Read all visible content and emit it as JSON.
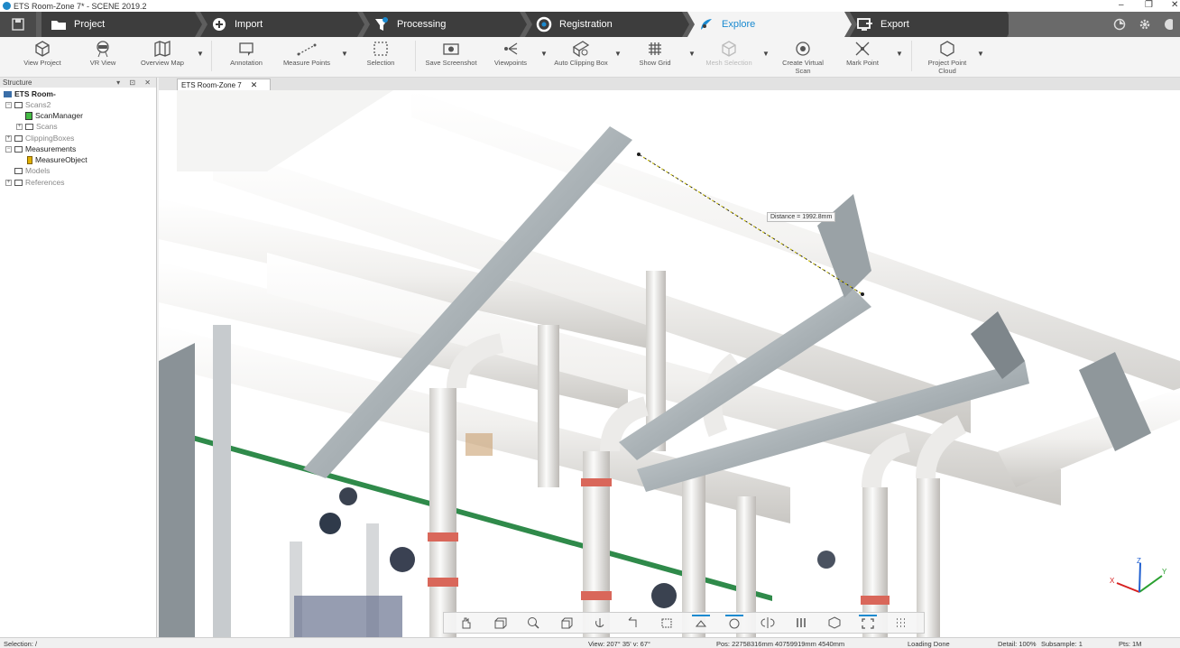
{
  "window": {
    "title": "ETS Room-Zone 7* - SCENE 2019.2",
    "controls": [
      "–",
      "❐",
      "✕"
    ]
  },
  "tabs": [
    {
      "label": "Project",
      "icon": "folder-icon"
    },
    {
      "label": "Import",
      "icon": "import-icon"
    },
    {
      "label": "Processing",
      "icon": "processing-icon"
    },
    {
      "label": "Registration",
      "icon": "registration-icon"
    },
    {
      "label": "Explore",
      "icon": "explore-icon",
      "active": true
    },
    {
      "label": "Export",
      "icon": "export-icon"
    }
  ],
  "ribbon": [
    {
      "label": "View Project",
      "icon": "cube-icon"
    },
    {
      "label": "VR View",
      "icon": "vr-icon"
    },
    {
      "label": "Overview Map",
      "icon": "map-icon"
    },
    {
      "label": "Annotation",
      "icon": "annotation-icon"
    },
    {
      "label": "Measure Points",
      "icon": "measure-icon"
    },
    {
      "label": "Selection",
      "icon": "selection-icon"
    },
    {
      "label": "Save Screenshot",
      "icon": "camera-icon"
    },
    {
      "label": "Viewpoints",
      "icon": "viewpoints-icon"
    },
    {
      "label": "Auto Clipping Box",
      "icon": "clipping-icon"
    },
    {
      "label": "Show Grid",
      "icon": "grid-icon"
    },
    {
      "label": "Mesh Selection",
      "icon": "mesh-icon",
      "disabled": true
    },
    {
      "label": "Create Virtual\nScan",
      "icon": "virtual-scan-icon"
    },
    {
      "label": "Mark Point",
      "icon": "mark-point-icon"
    },
    {
      "label": "Project Point\nCloud",
      "icon": "point-cloud-icon"
    }
  ],
  "structure": {
    "title": "Structure",
    "controls": "▾ ⊡ ✕",
    "nodes": [
      {
        "label": "ETS Room-"
      },
      {
        "label": "Scans2"
      },
      {
        "label": "ScanManager"
      },
      {
        "label": "Scans"
      },
      {
        "label": "ClippingBoxes"
      },
      {
        "label": "Measurements"
      },
      {
        "label": "MeasureObject"
      },
      {
        "label": "Models"
      },
      {
        "label": "References"
      }
    ]
  },
  "document_tab": {
    "label": "ETS Room-Zone 7",
    "close": "✕"
  },
  "measurement": {
    "label": "Distance = 1992.8mm"
  },
  "axes": {
    "x": "X",
    "y": "Y",
    "z": "Z"
  },
  "status": {
    "selection": "Selection: /",
    "view": "View: 207° 35' v: 67°",
    "pos": "Pos: 22758316mm 40759919mm 4540mm",
    "loading": "Loading Done",
    "detail": "Detail: 100%",
    "subsample": "Subsample: 1",
    "pts": "Pts: 1M"
  },
  "colors": {
    "accent": "#1a8ad0",
    "tab_bg": "#3d3d3d",
    "pipe": "#e9e8e6",
    "pipe_band": "#d9675a",
    "green_pipe": "#2f8a4a"
  }
}
